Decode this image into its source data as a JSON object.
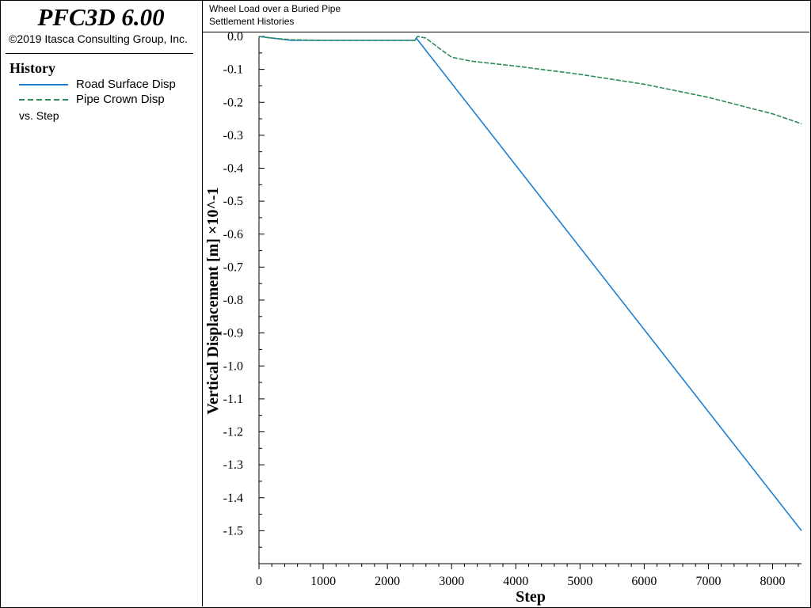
{
  "sidebar": {
    "app_title": "PFC3D 6.00",
    "copyright": "©2019 Itasca Consulting Group, Inc.",
    "history_heading": "History",
    "legend": [
      {
        "label": "Road Surface Disp",
        "color": "#1f7fd4",
        "style": "solid"
      },
      {
        "label": "Pipe Crown Disp",
        "color": "#2e8b57",
        "style": "dashed"
      }
    ],
    "vs_label": "vs. Step"
  },
  "plot": {
    "title": "Wheel Load over a Buried Pipe",
    "subtitle": "Settlement Histories"
  },
  "chart_data": {
    "type": "line",
    "title": "Wheel Load over a Buried Pipe",
    "subtitle": "Settlement Histories",
    "xlabel": "Step",
    "ylabel": "Vertical Displacement [m] ×10^-1",
    "xlim": [
      0,
      8450
    ],
    "ylim": [
      -1.6,
      0.0
    ],
    "x_ticks": [
      0,
      1000,
      2000,
      3000,
      4000,
      5000,
      6000,
      7000,
      8000
    ],
    "y_ticks": [
      0.0,
      -0.1,
      -0.2,
      -0.3,
      -0.4,
      -0.5,
      -0.6,
      -0.7,
      -0.8,
      -0.9,
      -1.0,
      -1.1,
      -1.2,
      -1.3,
      -1.4,
      -1.5
    ],
    "y_tick_labels": [
      "0.0",
      "-0.1",
      "-0.2",
      "-0.3",
      "-0.4",
      "-0.5",
      "-0.6",
      "-0.7",
      "-0.8",
      "-0.9",
      "-1.0",
      "-1.1",
      "-1.2",
      "-1.3",
      "-1.4",
      "-1.5"
    ],
    "grid": false,
    "series": [
      {
        "name": "Road Surface Disp",
        "color": "#1f7fd4",
        "style": "solid",
        "points": [
          [
            0,
            0.0
          ],
          [
            200,
            -0.005
          ],
          [
            500,
            -0.012
          ],
          [
            1000,
            -0.012
          ],
          [
            2000,
            -0.012
          ],
          [
            2430,
            -0.012
          ],
          [
            2450,
            -0.005
          ],
          [
            8450,
            -1.5
          ]
        ]
      },
      {
        "name": "Pipe Crown Disp",
        "color": "#2e8b57",
        "style": "dashed",
        "points": [
          [
            0,
            0.0
          ],
          [
            200,
            -0.005
          ],
          [
            500,
            -0.01
          ],
          [
            1000,
            -0.012
          ],
          [
            2000,
            -0.012
          ],
          [
            2430,
            -0.012
          ],
          [
            2470,
            0.0
          ],
          [
            2600,
            -0.005
          ],
          [
            2800,
            -0.035
          ],
          [
            3000,
            -0.063
          ],
          [
            3300,
            -0.075
          ],
          [
            4000,
            -0.09
          ],
          [
            5000,
            -0.115
          ],
          [
            6000,
            -0.145
          ],
          [
            7000,
            -0.185
          ],
          [
            8000,
            -0.235
          ],
          [
            8450,
            -0.265
          ]
        ]
      }
    ]
  }
}
